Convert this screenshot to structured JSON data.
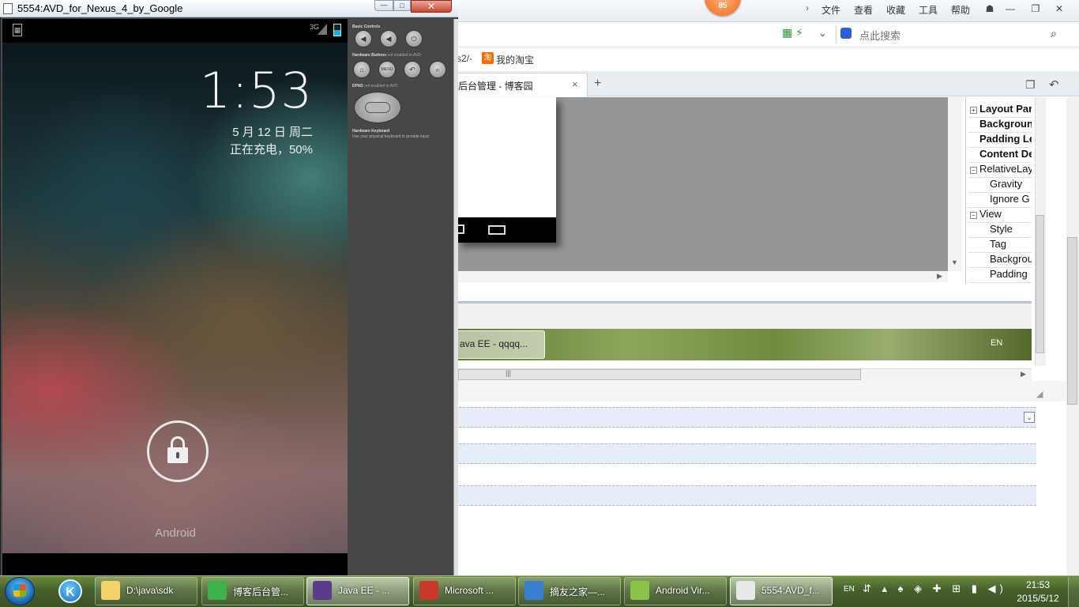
{
  "browser": {
    "score_badge": "85",
    "menu": {
      "file": "文件",
      "view": "查看",
      "favorites": "收藏",
      "tools": "工具",
      "help": "帮助"
    },
    "search_placeholder": "点此搜索",
    "bookmarks": {
      "partial_url": "s2/-",
      "taobao_icon": "淘",
      "taobao": "我的淘宝"
    },
    "active_tab": "后台管理 - 博客园",
    "tab_close": "×",
    "tab_add": "+"
  },
  "properties_panel": {
    "rows": [
      {
        "label": "Layout Par",
        "bold": true,
        "toggle": "+"
      },
      {
        "label": "Backgroun",
        "bold": true
      },
      {
        "label": "Padding Le",
        "bold": true
      },
      {
        "label": "Content De",
        "bold": true
      },
      {
        "label": "RelativeLay",
        "bold": false,
        "toggle": "−"
      },
      {
        "label": "Gravity",
        "bold": false
      },
      {
        "label": "Ignore G",
        "bold": false
      },
      {
        "label": "View",
        "bold": false,
        "toggle": "−"
      },
      {
        "label": "Style",
        "bold": false
      },
      {
        "label": "Tag",
        "bold": false
      },
      {
        "label": "Backgrou",
        "bold": false
      },
      {
        "label": "Padding",
        "bold": false
      }
    ]
  },
  "inner_taskbar": {
    "item": "ava EE - qqqq...",
    "tray": "EN"
  },
  "emulator": {
    "window_title": "5554:AVD_for_Nexus_4_by_Google",
    "min_glyph": "—",
    "max_glyph": "□",
    "close_glyph": "✕",
    "status_bar": {
      "network": "3G"
    },
    "lock_screen": {
      "time": "1:53",
      "date": "5 月 12 日 周二",
      "charging": "正在充电，50%",
      "carrier": "Android"
    },
    "controls": {
      "basic_heading": "Basic Controls",
      "hardware_heading": "Hardware Buttons",
      "hardware_note": "not enabled in AVD",
      "dpad_heading": "DPAD",
      "dpad_note": "not enabled in AVD",
      "keyboard_heading": "Hardware Keyboard",
      "keyboard_note": "Use your physical keyboard to provide input",
      "menu_label": "MENU"
    }
  },
  "taskbar": {
    "items": [
      {
        "label": "D:\\java\\sdk",
        "icon": "folder-icon",
        "color": "#f4d36b"
      },
      {
        "label": "博客后台管...",
        "icon": "browser-icon",
        "color": "#3fb24a"
      },
      {
        "label": "Java EE - ...",
        "icon": "eclipse-icon",
        "color": "#5b3c8c",
        "active": true
      },
      {
        "label": "Microsoft ...",
        "icon": "office-icon",
        "color": "#c8392b"
      },
      {
        "label": "摘友之家—...",
        "icon": "notes-icon",
        "color": "#3a7fd0"
      },
      {
        "label": "Android Vir...",
        "icon": "android-icon",
        "color": "#8bc34a"
      },
      {
        "label": "5554:AVD_f...",
        "icon": "emulator-icon",
        "color": "#e8e8e8",
        "active": true
      }
    ],
    "tray": {
      "lang": "EN",
      "time": "21:53",
      "date": "2015/5/12"
    }
  }
}
